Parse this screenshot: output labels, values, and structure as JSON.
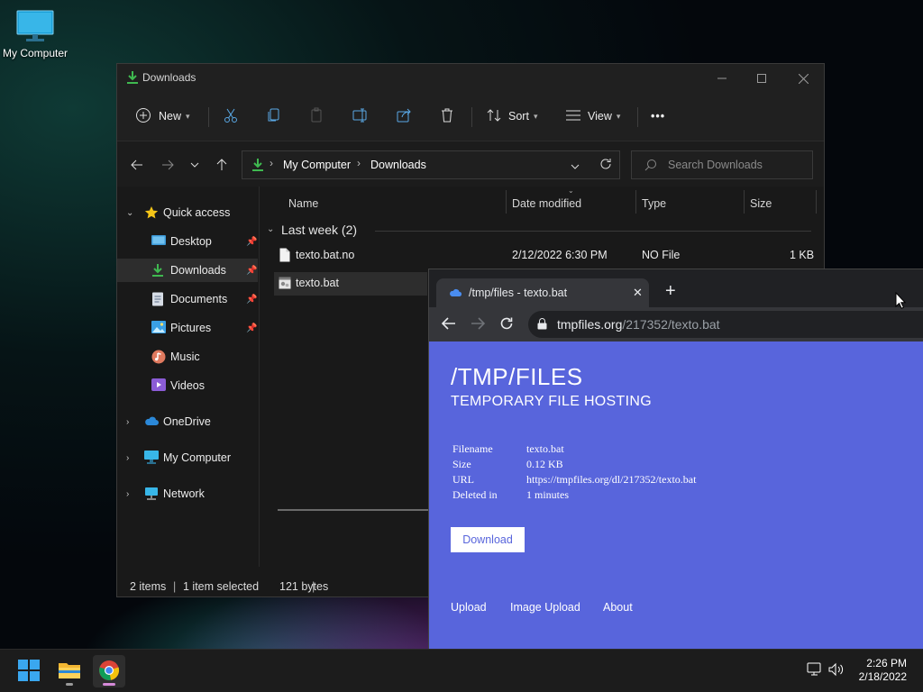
{
  "desktop": {
    "icon_label": "My Computer"
  },
  "explorer": {
    "title": "Downloads",
    "toolbar": {
      "new_label": "New",
      "sort_label": "Sort",
      "view_label": "View",
      "more_label": "•••"
    },
    "address": {
      "crumbs": [
        "My Computer",
        "Downloads"
      ]
    },
    "search": {
      "placeholder": "Search Downloads"
    },
    "nav": {
      "quick_access": "Quick access",
      "items": [
        {
          "label": "Desktop",
          "pinned": true
        },
        {
          "label": "Downloads",
          "pinned": true,
          "selected": true
        },
        {
          "label": "Documents",
          "pinned": true
        },
        {
          "label": "Pictures",
          "pinned": true
        },
        {
          "label": "Music",
          "pinned": false
        },
        {
          "label": "Videos",
          "pinned": false
        }
      ],
      "onedrive": "OneDrive",
      "my_computer": "My Computer",
      "network": "Network"
    },
    "columns": {
      "name": "Name",
      "date": "Date modified",
      "type": "Type",
      "size": "Size"
    },
    "group": "Last week (2)",
    "files": [
      {
        "name": "texto.bat.no",
        "date": "2/12/2022 6:30 PM",
        "type": "NO File",
        "size": "1 KB"
      },
      {
        "name": "texto.bat",
        "date": "",
        "type": "",
        "size": ""
      }
    ],
    "status": {
      "count": "2 items",
      "selection": "1 item selected",
      "bytes": "121 bytes",
      "sep": "|"
    }
  },
  "browser": {
    "tab_title": "/tmp/files - texto.bat",
    "url_host": "tmpfiles.org",
    "url_path": "/217352/texto.bat",
    "page": {
      "title": "/TMP/FILES",
      "subtitle": "TEMPORARY FILE HOSTING",
      "info": [
        {
          "key": "Filename",
          "value": "texto.bat"
        },
        {
          "key": "Size",
          "value": "0.12 KB"
        },
        {
          "key": "URL",
          "value": "https://tmpfiles.org/dl/217352/texto.bat"
        },
        {
          "key": "Deleted in",
          "value": "1 minutes"
        }
      ],
      "download_label": "Download",
      "links": [
        "Upload",
        "Image Upload",
        "About"
      ],
      "bg_color": "#5865dc"
    }
  },
  "taskbar": {
    "time": "2:26 PM",
    "date": "2/18/2022"
  }
}
